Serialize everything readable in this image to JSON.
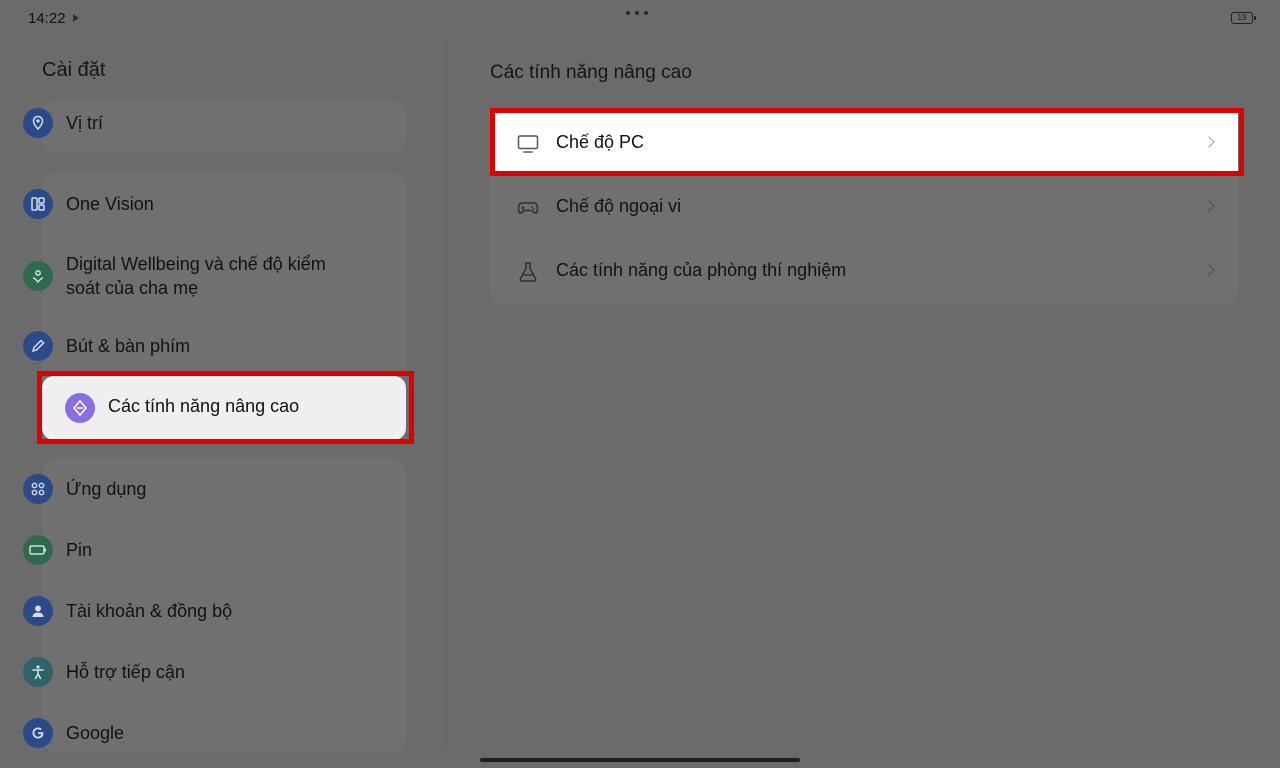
{
  "status_bar": {
    "time": "14:22",
    "battery": "19"
  },
  "left_panel": {
    "title": "Cài đặt",
    "items": [
      {
        "label": "Vị trí",
        "icon": "location-pin-icon"
      },
      {
        "label": "One Vision",
        "icon": "one-vision-icon"
      },
      {
        "label": "Digital Wellbeing và chế độ kiểm",
        "label2": "soát của cha mẹ",
        "icon": "wellbeing-icon"
      },
      {
        "label": "Bút & bàn phím",
        "icon": "pencil-icon"
      },
      {
        "label": "Các tính năng nâng cao",
        "icon": "advanced-features-icon",
        "selected": true
      },
      {
        "label": "Ứng dụng",
        "icon": "apps-grid-icon"
      },
      {
        "label": "Pin",
        "icon": "battery-icon"
      },
      {
        "label": "Tài khoản & đồng bộ",
        "icon": "account-icon"
      },
      {
        "label": "Hỗ trợ tiếp cận",
        "icon": "accessibility-icon"
      },
      {
        "label": "Google",
        "icon": "google-icon"
      }
    ]
  },
  "right_panel": {
    "title": "Các tính năng nâng cao",
    "items": [
      {
        "label": "Chế độ PC",
        "icon": "monitor-icon",
        "highlighted": true
      },
      {
        "label": "Chế độ ngoại vi",
        "icon": "gamepad-icon"
      },
      {
        "label": "Các tính năng của phòng thí nghiệm",
        "icon": "lab-flask-icon"
      }
    ]
  },
  "colors": {
    "highlight": "#e00000",
    "background_dimmed": "#6b6b6b"
  }
}
